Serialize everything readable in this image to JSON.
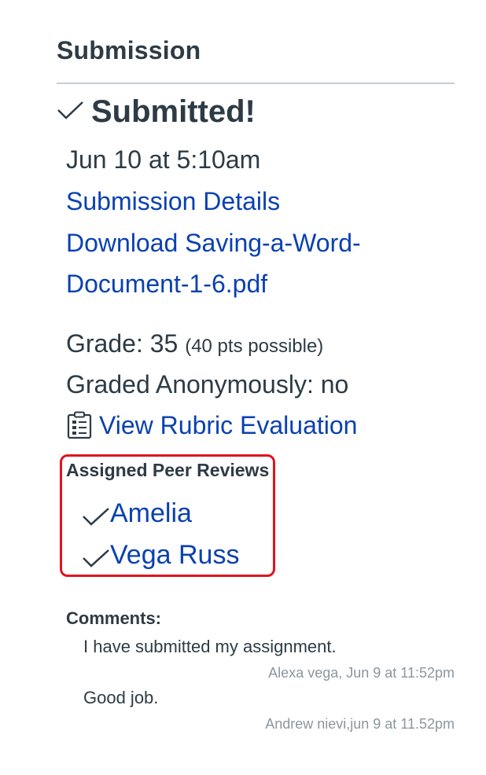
{
  "submission": {
    "title": "Submission",
    "status": "Submitted!",
    "date": "Jun 10 at 5:10am",
    "details_link": "Submission Details",
    "download_line1": "Download Saving-a-Word-",
    "download_line2": "Document-1-6.pdf",
    "grade_label": "Grade: 35",
    "grade_possible": "(40 pts possible)",
    "anonymous": "Graded Anonymously: no",
    "rubric_link": "View Rubric Evaluation"
  },
  "peer_reviews": {
    "title": "Assigned Peer Reviews",
    "items": [
      {
        "name": "Amelia"
      },
      {
        "name": "Vega Russ"
      }
    ]
  },
  "comments": {
    "title": "Comments:",
    "items": [
      {
        "text": "I have submitted my assignment.",
        "meta": "Alexa vega, Jun 9 at 11:52pm"
      },
      {
        "text": "Good job.",
        "meta": "Andrew nievi,jun 9 at 11.52pm"
      }
    ]
  },
  "colors": {
    "link": "#0a41b0",
    "text": "#2d3b45",
    "muted": "#8b969e",
    "highlight": "#e0141e"
  }
}
